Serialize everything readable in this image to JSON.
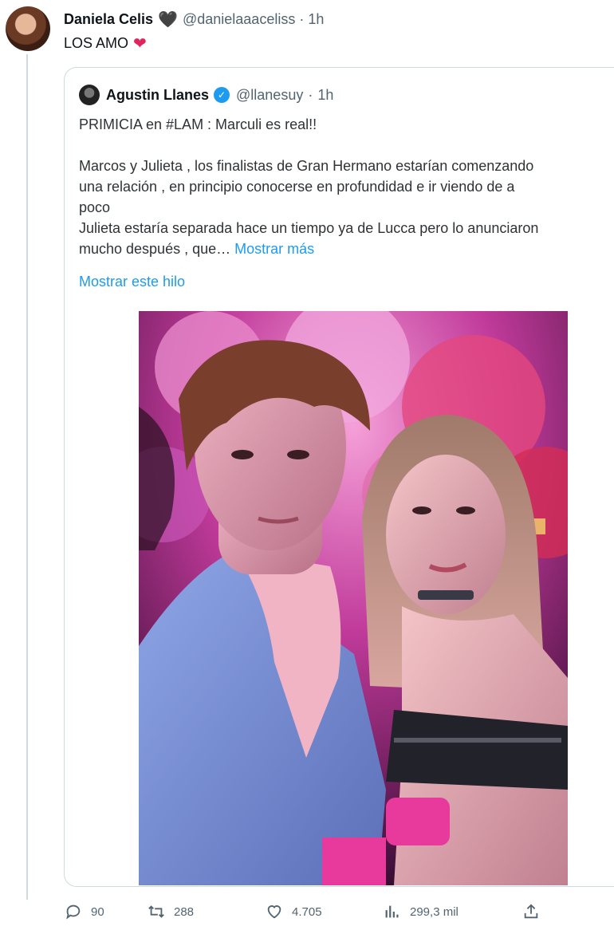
{
  "tweet": {
    "author_name": "Daniela Celis",
    "author_emoji": "🖤",
    "handle": "@danielaaaceliss",
    "separator": "·",
    "time": "1h",
    "text": "LOS AMO",
    "text_emoji": "❤"
  },
  "quote": {
    "author_name": "Agustin Llanes",
    "verified_icon": "verified-badge",
    "handle": "@llanesuy",
    "separator": "·",
    "time": "1h",
    "line1": "PRIMICIA en #LAM : Marculi es real!!",
    "line2": "Marcos y Julieta , los finalistas de Gran Hermano estarían comenzando",
    "line3": "una relación , en principio conocerse en profundidad e ir viendo de a",
    "line4": "poco",
    "line5": "Julieta estaría separada hace un tiempo ya de Lucca pero lo anunciaron",
    "line6_prefix": "mucho después , que…",
    "show_more": "Mostrar más",
    "show_thread": "Mostrar este hilo"
  },
  "actions": {
    "replies": "90",
    "retweets": "288",
    "likes": "4.705",
    "views": "299,3 mil"
  },
  "colors": {
    "accent": "#1d9bf0",
    "secondary_text": "#536471",
    "heart": "#e0245e"
  }
}
